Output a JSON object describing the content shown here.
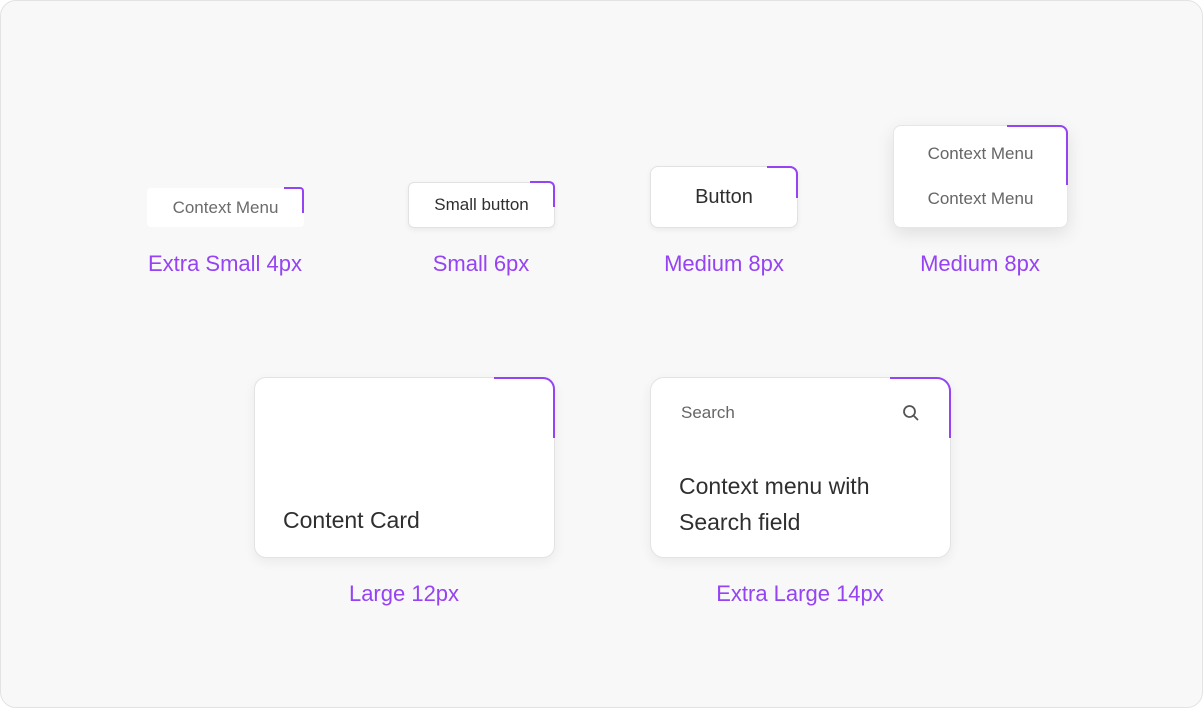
{
  "items": {
    "xs": {
      "text": "Context Menu",
      "label": "Extra Small 4px"
    },
    "sm": {
      "text": "Small button",
      "label": "Small 6px"
    },
    "md": {
      "text": "Button",
      "label": "Medium 8px"
    },
    "md_menu": {
      "items": [
        "Context Menu",
        "Context Menu"
      ],
      "label": "Medium 8px"
    },
    "lg": {
      "text": "Content Card",
      "label": "Large 12px"
    },
    "xl": {
      "search_placeholder": "Search",
      "text_line1": "Context menu with",
      "text_line2": "Search field",
      "label": "Extra Large 14px"
    }
  },
  "colors": {
    "accent": "#9543f3",
    "background": "#f8f8f8",
    "surface": "#ffffff",
    "text": "#2f2f2f",
    "muted_text": "#6b6b6b",
    "border": "#e3e3e3"
  },
  "icons": {
    "search": "search-icon"
  }
}
